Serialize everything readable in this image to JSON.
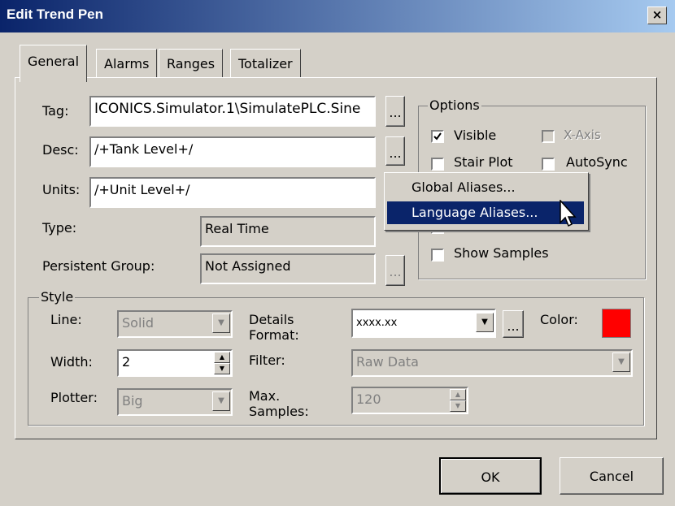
{
  "window": {
    "title": "Edit Trend Pen",
    "close_label": "×"
  },
  "tabs": [
    {
      "label": "General",
      "active": true
    },
    {
      "label": "Alarms"
    },
    {
      "label": "Ranges"
    },
    {
      "label": "Totalizer"
    }
  ],
  "general": {
    "tag_label": "Tag:",
    "tag_value": "ICONICS.Simulator.1\\SimulatePLC.Sine",
    "desc_label": "Desc:",
    "desc_value": "/+Tank Level+/",
    "units_label": "Units:",
    "units_value": "/+Unit Level+/",
    "type_label": "Type:",
    "type_value": "Real Time",
    "persistent_label": "Persistent Group:",
    "persistent_value": "Not  Assigned",
    "browse_label": "..."
  },
  "options": {
    "legend": "Options",
    "visible": "Visible",
    "visible_checked": true,
    "xaxis": "X-Axis",
    "stair": "Stair Plot",
    "autosync": "AutoSync",
    "show_samples": "Show Samples"
  },
  "context_menu": {
    "items": [
      {
        "label": "Global Aliases..."
      },
      {
        "label": "Language Aliases...",
        "highlighted": true
      }
    ]
  },
  "style": {
    "legend": "Style",
    "line_label": "Line:",
    "line_value": "Solid",
    "width_label": "Width:",
    "width_value": "2",
    "plotter_label": "Plotter:",
    "plotter_value": "Big",
    "details_label": "Details\nFormat:",
    "details_value": "xxxx.xx",
    "filter_label": "Filter:",
    "filter_value": "Raw Data",
    "max_label": "Max.\nSamples:",
    "max_value": "120",
    "color_label": "Color:",
    "color_value": "#ff0000"
  },
  "buttons": {
    "ok": "OK",
    "cancel": "Cancel"
  }
}
